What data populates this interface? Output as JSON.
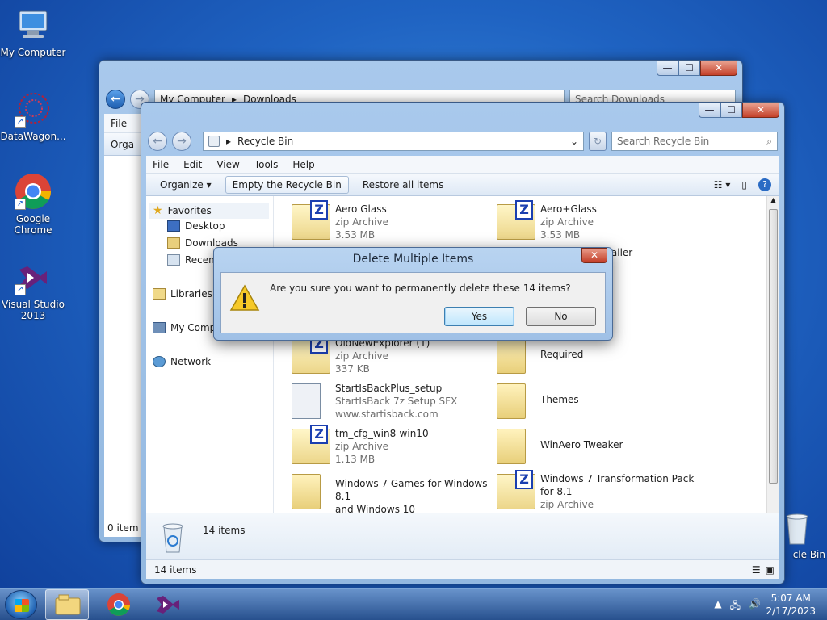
{
  "desktop": {
    "icons": [
      {
        "label": "My Computer"
      },
      {
        "label": "DataWagon..."
      },
      {
        "label": "Google Chrome"
      },
      {
        "label": "Visual Studio 2013"
      },
      {
        "label": "Recycle Bin"
      }
    ]
  },
  "back_window": {
    "breadcrumb": [
      "My Computer",
      "Downloads"
    ],
    "search_placeholder": "Search Downloads",
    "menu_file": "File",
    "organize": "Orga",
    "status": "0 item",
    "recycle_partial": "cle Bin"
  },
  "window": {
    "breadcrumb": "Recycle Bin",
    "search_placeholder": "Search Recycle Bin",
    "menu": [
      "File",
      "Edit",
      "View",
      "Tools",
      "Help"
    ],
    "commands": {
      "organize": "Organize",
      "empty": "Empty the Recycle Bin",
      "restore": "Restore all items"
    },
    "nav": {
      "favorites": "Favorites",
      "desktop": "Desktop",
      "downloads": "Downloads",
      "recent": "Recent Places",
      "libraries": "Libraries",
      "computer": "My Computer",
      "network": "Network"
    },
    "files": [
      {
        "name": "Aero Glass",
        "type": "zip Archive",
        "size": "3.53 MB",
        "icon": "zip"
      },
      {
        "name": "Aero+Glass",
        "type": "zip Archive",
        "size": "3.53 MB",
        "icon": "zip"
      },
      {
        "name": "installer",
        "type": "",
        "size": "",
        "icon": "exe"
      },
      {
        "name": "OldNewExplorer (1)",
        "type": "zip Archive",
        "size": "337 KB",
        "icon": "zip"
      },
      {
        "name": "Required",
        "type": "",
        "size": "",
        "icon": "folder"
      },
      {
        "name": "StartIsBackPlus_setup",
        "type": "StartIsBack 7z Setup SFX",
        "size": "www.startisback.com",
        "icon": "setup"
      },
      {
        "name": "Themes",
        "type": "",
        "size": "",
        "icon": "folder"
      },
      {
        "name": "tm_cfg_win8-win10",
        "type": "zip Archive",
        "size": "1.13 MB",
        "icon": "zip"
      },
      {
        "name": "WinAero Tweaker",
        "type": "",
        "size": "",
        "icon": "folder"
      },
      {
        "name": "Windows 7 Games for Windows 8.1",
        "name2": "and Windows 10",
        "type": "",
        "size": "",
        "icon": "folder"
      },
      {
        "name": "Windows 7 Transformation Pack",
        "name2": "for 8.1",
        "type": "zip Archive",
        "size": "",
        "icon": "zip"
      }
    ],
    "details_count": "14 items",
    "status_count": "14 items"
  },
  "dialog": {
    "title": "Delete Multiple Items",
    "message": "Are you sure you want to permanently delete these 14 items?",
    "yes": "Yes",
    "no": "No"
  },
  "taskbar": {
    "time": "5:07 AM",
    "date": "2/17/2023"
  },
  "colors": {
    "desktop": "#1f63c2",
    "taskbar": "#2f5a94",
    "zip_badge": "#1b3fb0",
    "close_button": "#c4412a"
  }
}
